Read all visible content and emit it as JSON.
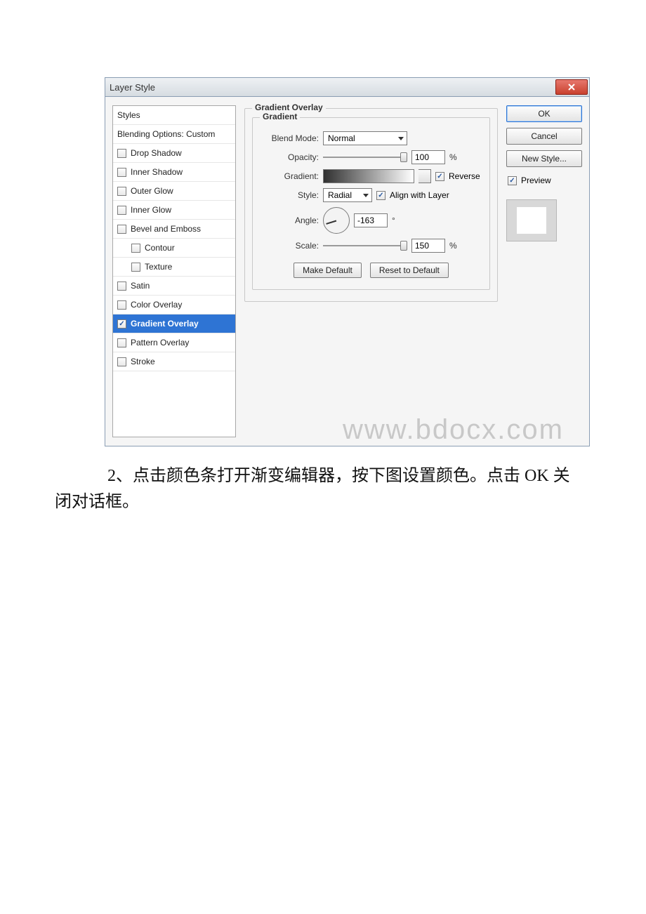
{
  "dialog": {
    "title": "Layer Style",
    "styles_header": "Styles",
    "blending_options": "Blending Options: Custom",
    "effects": [
      {
        "label": "Drop Shadow",
        "checked": false
      },
      {
        "label": "Inner Shadow",
        "checked": false
      },
      {
        "label": "Outer Glow",
        "checked": false
      },
      {
        "label": "Inner Glow",
        "checked": false
      },
      {
        "label": "Bevel and Emboss",
        "checked": false
      },
      {
        "label": "Contour",
        "checked": false,
        "indent": true
      },
      {
        "label": "Texture",
        "checked": false,
        "indent": true
      },
      {
        "label": "Satin",
        "checked": false
      },
      {
        "label": "Color Overlay",
        "checked": false
      },
      {
        "label": "Gradient Overlay",
        "checked": true,
        "selected": true
      },
      {
        "label": "Pattern Overlay",
        "checked": false
      },
      {
        "label": "Stroke",
        "checked": false
      }
    ],
    "group_title": "Gradient Overlay",
    "gradient_title": "Gradient",
    "labels": {
      "blend_mode": "Blend Mode:",
      "opacity": "Opacity:",
      "gradient": "Gradient:",
      "style": "Style:",
      "angle": "Angle:",
      "scale": "Scale:"
    },
    "values": {
      "blend_mode": "Normal",
      "opacity": "100",
      "opacity_unit": "%",
      "reverse_label": "Reverse",
      "reverse_checked": true,
      "style": "Radial",
      "align_label": "Align with Layer",
      "align_checked": true,
      "angle": "-163",
      "angle_unit": "°",
      "scale": "150",
      "scale_unit": "%"
    },
    "buttons": {
      "make_default": "Make Default",
      "reset_default": "Reset to Default",
      "ok": "OK",
      "cancel": "Cancel",
      "new_style": "New Style...",
      "preview": "Preview"
    }
  },
  "watermark": "www.bdocx.com",
  "caption_first": "2、点击颜色条打开渐变编辑器，按下图设置颜色。点击 OK 关",
  "caption_second": "闭对话框。"
}
